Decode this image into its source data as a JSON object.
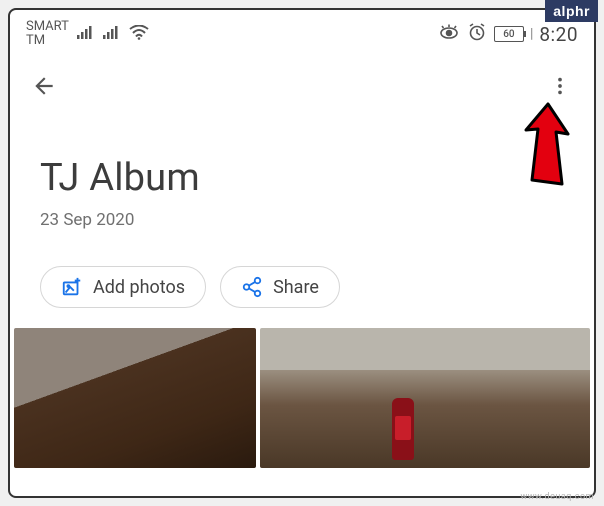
{
  "status_bar": {
    "carrier_line1": "SMART",
    "carrier_line2": "TM",
    "battery_pct": "60",
    "clock": "8:20"
  },
  "album": {
    "title": "TJ Album",
    "date": "23 Sep 2020"
  },
  "actions": {
    "add_photos": "Add photos",
    "share": "Share"
  },
  "badge": {
    "text": "alphr"
  },
  "watermark": "www.deuaq.com",
  "colors": {
    "accent_blue": "#1a73e8",
    "text_primary": "#3c3c3c",
    "text_secondary": "#707070",
    "arrow_fill": "#e3000f",
    "arrow_stroke": "#000000"
  }
}
